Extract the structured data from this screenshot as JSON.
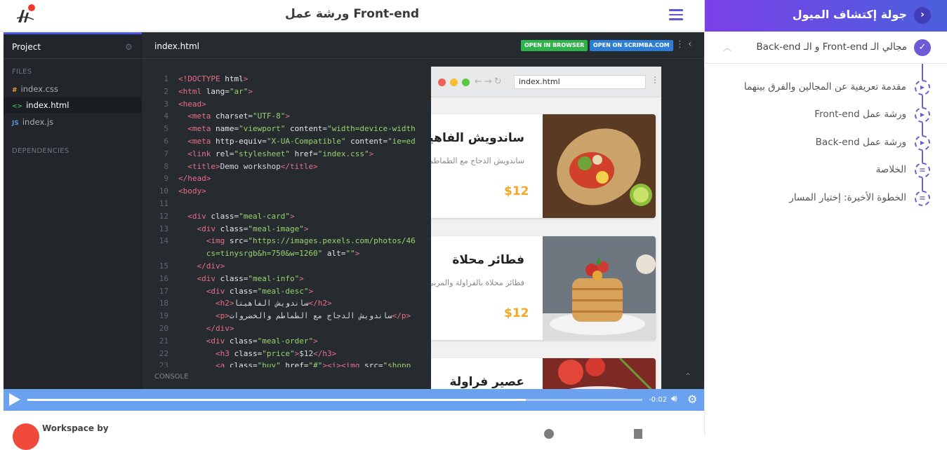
{
  "header": {
    "course_title": "ورشة عمل Front-end"
  },
  "editor": {
    "project_label": "Project",
    "files_label": "FILES",
    "dependencies_label": "DEPENDENCIES",
    "files": [
      {
        "icon": "#",
        "name": "index.css"
      },
      {
        "icon": "<>",
        "name": "index.html"
      },
      {
        "icon": "JS",
        "name": "index.js"
      }
    ],
    "tab_name": "index.html",
    "open_in_browser": "OPEN IN BROWSER",
    "open_on_scrimba": "OPEN ON SCRIMBA.COM",
    "console_label": "CONSOLE",
    "code_lines": [
      {
        "n": "1",
        "segs": [
          [
            "t",
            "<!DOCTYPE"
          ],
          [
            "a",
            " html"
          ],
          [
            "t",
            ">"
          ]
        ]
      },
      {
        "n": "2",
        "segs": [
          [
            "t",
            "<html"
          ],
          [
            "a",
            " lang"
          ],
          [
            "x",
            "="
          ],
          [
            "s",
            "\"ar\""
          ],
          [
            "t",
            ">"
          ]
        ]
      },
      {
        "n": "3",
        "segs": [
          [
            "t",
            "<head>"
          ]
        ]
      },
      {
        "n": "4",
        "segs": [
          [
            "x",
            "  "
          ],
          [
            "t",
            "<meta"
          ],
          [
            "a",
            " charset"
          ],
          [
            "x",
            "="
          ],
          [
            "s",
            "\"UTF-8\""
          ],
          [
            "t",
            ">"
          ]
        ]
      },
      {
        "n": "5",
        "segs": [
          [
            "x",
            "  "
          ],
          [
            "t",
            "<meta"
          ],
          [
            "a",
            " name"
          ],
          [
            "x",
            "="
          ],
          [
            "s",
            "\"viewport\""
          ],
          [
            "a",
            " content"
          ],
          [
            "x",
            "="
          ],
          [
            "s",
            "\"width=device-width"
          ]
        ]
      },
      {
        "n": "6",
        "segs": [
          [
            "x",
            "  "
          ],
          [
            "t",
            "<meta"
          ],
          [
            "a",
            " http-equiv"
          ],
          [
            "x",
            "="
          ],
          [
            "s",
            "\"X-UA-Compatible\""
          ],
          [
            "a",
            " content"
          ],
          [
            "x",
            "="
          ],
          [
            "s",
            "\"ie=ed"
          ]
        ]
      },
      {
        "n": "7",
        "segs": [
          [
            "x",
            "  "
          ],
          [
            "t",
            "<link"
          ],
          [
            "a",
            " rel"
          ],
          [
            "x",
            "="
          ],
          [
            "s",
            "\"stylesheet\""
          ],
          [
            "a",
            " href"
          ],
          [
            "x",
            "="
          ],
          [
            "s",
            "\"index.css\""
          ],
          [
            "t",
            ">"
          ]
        ]
      },
      {
        "n": "8",
        "segs": [
          [
            "x",
            "  "
          ],
          [
            "t",
            "<title>"
          ],
          [
            "x",
            "Demo workshop"
          ],
          [
            "t",
            "</title>"
          ]
        ]
      },
      {
        "n": "9",
        "segs": [
          [
            "t",
            "</head>"
          ]
        ]
      },
      {
        "n": "10",
        "segs": [
          [
            "t",
            "<body>"
          ]
        ]
      },
      {
        "n": "11",
        "segs": []
      },
      {
        "n": "12",
        "segs": [
          [
            "x",
            "  "
          ],
          [
            "t",
            "<div"
          ],
          [
            "a",
            " class"
          ],
          [
            "x",
            "="
          ],
          [
            "s",
            "\"meal-card\""
          ],
          [
            "t",
            ">"
          ]
        ]
      },
      {
        "n": "13",
        "segs": [
          [
            "x",
            "    "
          ],
          [
            "t",
            "<div"
          ],
          [
            "a",
            " class"
          ],
          [
            "x",
            "="
          ],
          [
            "s",
            "\"meal-image\""
          ],
          [
            "t",
            ">"
          ]
        ]
      },
      {
        "n": "14",
        "segs": [
          [
            "x",
            "      "
          ],
          [
            "t",
            "<img"
          ],
          [
            "a",
            " src"
          ],
          [
            "x",
            "="
          ],
          [
            "s",
            "\"https://images.pexels.com/photos/46"
          ]
        ]
      },
      {
        "n": "",
        "segs": [
          [
            "s",
            "      cs=tinysrgb&h=750&w=1260\""
          ],
          [
            "a",
            " alt"
          ],
          [
            "x",
            "="
          ],
          [
            "s",
            "\"\""
          ],
          [
            "t",
            ">"
          ]
        ]
      },
      {
        "n": "15",
        "segs": [
          [
            "x",
            "    "
          ],
          [
            "t",
            "</div>"
          ]
        ]
      },
      {
        "n": "16",
        "segs": [
          [
            "x",
            "    "
          ],
          [
            "t",
            "<div"
          ],
          [
            "a",
            " class"
          ],
          [
            "x",
            "="
          ],
          [
            "s",
            "\"meal-info\""
          ],
          [
            "t",
            ">"
          ]
        ]
      },
      {
        "n": "17",
        "segs": [
          [
            "x",
            "      "
          ],
          [
            "t",
            "<div"
          ],
          [
            "a",
            " class"
          ],
          [
            "x",
            "="
          ],
          [
            "s",
            "\"meal-desc\""
          ],
          [
            "t",
            ">"
          ]
        ]
      },
      {
        "n": "18",
        "segs": [
          [
            "x",
            "        "
          ],
          [
            "t",
            "<h2>"
          ],
          [
            "x",
            "ساندويش الفاهيتا"
          ],
          [
            "t",
            "</h2>"
          ]
        ]
      },
      {
        "n": "19",
        "segs": [
          [
            "x",
            "        "
          ],
          [
            "t",
            "<p>"
          ],
          [
            "x",
            "ساندويش الدجاج مع الطماطم والخضروات"
          ],
          [
            "t",
            "</p>"
          ]
        ]
      },
      {
        "n": "20",
        "segs": [
          [
            "x",
            "      "
          ],
          [
            "t",
            "</div>"
          ]
        ]
      },
      {
        "n": "21",
        "segs": [
          [
            "x",
            "      "
          ],
          [
            "t",
            "<div"
          ],
          [
            "a",
            " class"
          ],
          [
            "x",
            "="
          ],
          [
            "s",
            "\"meal-order\""
          ],
          [
            "t",
            ">"
          ]
        ]
      },
      {
        "n": "22",
        "segs": [
          [
            "x",
            "        "
          ],
          [
            "t",
            "<h3"
          ],
          [
            "a",
            " class"
          ],
          [
            "x",
            "="
          ],
          [
            "s",
            "\"price\""
          ],
          [
            "t",
            ">"
          ],
          [
            "x",
            "$12"
          ],
          [
            "t",
            "</h3>"
          ]
        ]
      },
      {
        "n": "23",
        "segs": [
          [
            "x",
            "        "
          ],
          [
            "t",
            "<a"
          ],
          [
            "a",
            " class"
          ],
          [
            "x",
            "="
          ],
          [
            "s",
            "\"buy\""
          ],
          [
            "a",
            " href"
          ],
          [
            "x",
            "="
          ],
          [
            "s",
            "\"#\""
          ],
          [
            "t",
            "><i><img"
          ],
          [
            "a",
            " src"
          ],
          [
            "x",
            "="
          ],
          [
            "s",
            "\"shopp"
          ]
        ]
      }
    ]
  },
  "browser": {
    "url": "index.html",
    "cards": [
      {
        "name": "ساندويش الفاهيتا",
        "desc": "ساندويش الدجاج مع الطماطم والخضروات",
        "price": "$12"
      },
      {
        "name": "فطائر محلاة",
        "desc": "فطائر محلاة بالفراولة والمربى",
        "price": "$12"
      },
      {
        "name": "عصير فراولة",
        "desc": "",
        "price": ""
      }
    ]
  },
  "player": {
    "time": "-0:02",
    "progress": 0.81
  },
  "below": {
    "text": "Workspace by"
  },
  "sidebar": {
    "title": "جولة إكتشاف الميول",
    "section_title": "مجالي الـ Front-end و الـ Back-end",
    "lessons": [
      {
        "title": "مقدمة تعريفية عن المجالين والفرق بينهما",
        "icon": "play-icon"
      },
      {
        "title": "ورشة عمل Front-end",
        "icon": "play-icon"
      },
      {
        "title": "ورشة عمل Back-end",
        "icon": "play-icon"
      },
      {
        "title": "الخلاصة",
        "icon": "list-icon"
      },
      {
        "title": "الخطوة الأخيرة: إختيار المسار",
        "icon": "list-icon"
      }
    ]
  }
}
